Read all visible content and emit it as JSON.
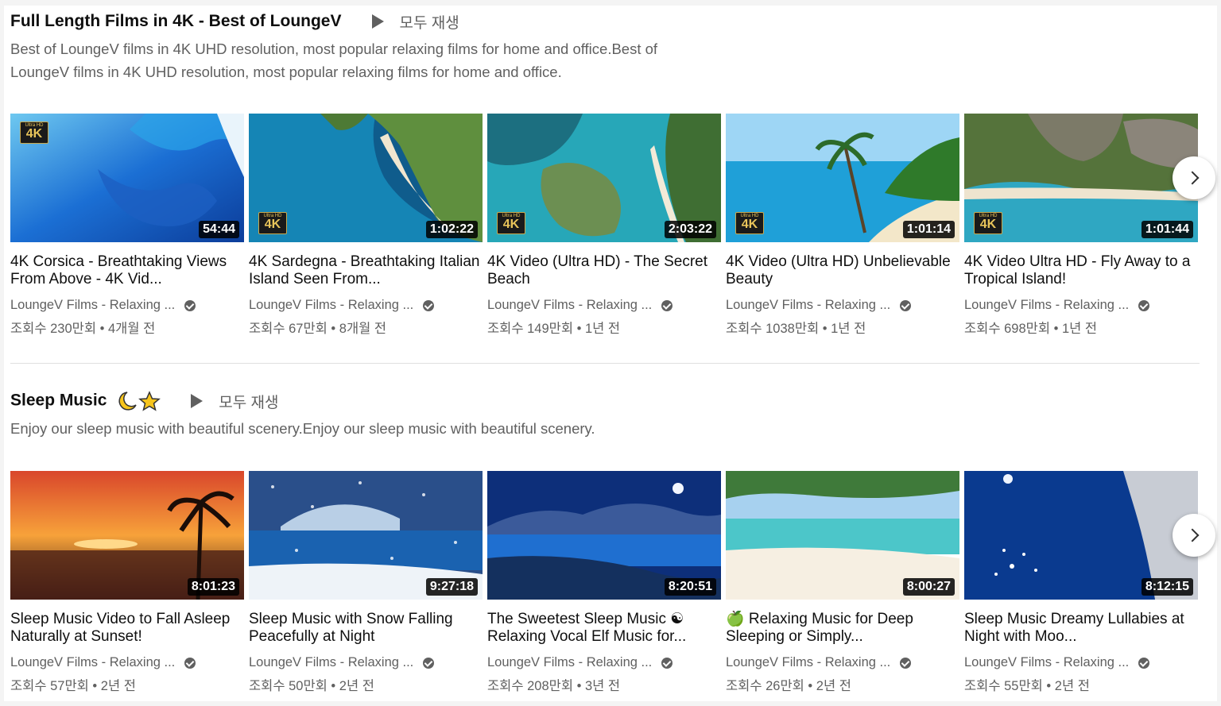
{
  "play_all_label": "모두 재생",
  "shelves": [
    {
      "title": "Full Length Films in 4K - Best of LoungeV",
      "description": "Best of LoungeV films in 4K UHD resolution, most popular relaxing films for home and office.Best of LoungeV films in 4K UHD resolution, most popular relaxing films for home and office.",
      "videos": [
        {
          "title": "4K Corsica - Breathtaking Views From Above - 4K Vid...",
          "duration": "54:44",
          "channel": "LoungeV Films - Relaxing ...",
          "meta": "조회수 230만회 • 4개월 전"
        },
        {
          "title": "4K Sardegna - Breathtaking Italian Island Seen From...",
          "duration": "1:02:22",
          "channel": "LoungeV Films - Relaxing ...",
          "meta": "조회수 67만회 • 8개월 전"
        },
        {
          "title": "4K Video (Ultra HD) - The Secret Beach",
          "duration": "2:03:22",
          "channel": "LoungeV Films - Relaxing ...",
          "meta": "조회수 149만회 • 1년 전"
        },
        {
          "title": "4K Video (Ultra HD) Unbelievable Beauty",
          "duration": "1:01:14",
          "channel": "LoungeV Films - Relaxing ...",
          "meta": "조회수 1038만회 • 1년 전"
        },
        {
          "title": "4K Video Ultra HD - Fly Away to a Tropical Island!",
          "duration": "1:01:44",
          "channel": "LoungeV Films - Relaxing ...",
          "meta": "조회수 698만회 • 1년 전"
        }
      ]
    },
    {
      "title": "Sleep Music",
      "description": "Enjoy our sleep music with beautiful scenery.Enjoy our sleep music with beautiful scenery.",
      "videos": [
        {
          "title": "Sleep Music Video to Fall Asleep Naturally at Sunset!",
          "duration": "8:01:23",
          "channel": "LoungeV Films - Relaxing ...",
          "meta": "조회수 57만회 • 2년 전"
        },
        {
          "title": "Sleep Music with Snow Falling Peacefully at Night",
          "duration": "9:27:18",
          "channel": "LoungeV Films - Relaxing ...",
          "meta": "조회수 50만회 • 2년 전"
        },
        {
          "title": "The Sweetest Sleep Music ☯ Relaxing Vocal Elf Music for...",
          "duration": "8:20:51",
          "channel": "LoungeV Films - Relaxing ...",
          "meta": "조회수 208만회 • 3년 전"
        },
        {
          "title": "🍏 Relaxing Music for Deep Sleeping or Simply...",
          "duration": "8:00:27",
          "channel": "LoungeV Films - Relaxing ...",
          "meta": "조회수 26만회 • 2년 전"
        },
        {
          "title": "Sleep Music Dreamy Lullabies at Night with Moo...",
          "duration": "8:12:15",
          "channel": "LoungeV Films - Relaxing ...",
          "meta": "조회수 55만회 • 2년 전"
        }
      ]
    }
  ],
  "badge_4k": "4K",
  "badge_uhd": "Ultra HD"
}
